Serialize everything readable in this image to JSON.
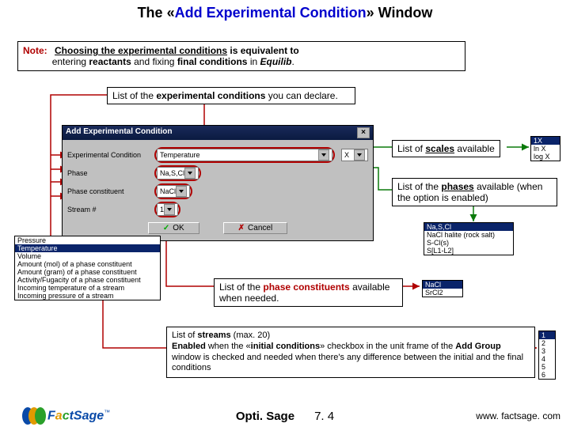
{
  "title": {
    "open": "The «",
    "name": "Add Experimental Condition",
    "close": "» ",
    "win": "Window"
  },
  "note": {
    "label": "Note:",
    "line1a": "Choosing the experimental conditions",
    "line1b": " is equivalent to",
    "line2a": "entering ",
    "line2b": "reactants",
    "line2c": " and fixing ",
    "line2d": "final conditions",
    "line2e": " in ",
    "line2f": "Equilib",
    "line2g": "."
  },
  "labels": {
    "list_exp_a": "List of the ",
    "list_exp_b": "experimental conditions",
    "list_exp_c": " you can declare.",
    "scales_a": "List of ",
    "scales_b": "scales",
    "scales_c": " available",
    "phases_a": "List of the ",
    "phases_b": "phases",
    "phases_c": " available (when the option is enabled)",
    "cons_a": "List of the ",
    "cons_b": "phase constituents",
    "cons_c": " available when needed.",
    "streams_a": "List of ",
    "streams_b": "streams",
    "streams_c": " (max. 20)",
    "streams_d": "Enabled",
    "streams_e": " when the «",
    "streams_f": "initial conditions",
    "streams_g": "» checkbox in the unit frame of the ",
    "streams_h": "Add Group",
    "streams_i": " window is checked and needed when there's any difference between the initial and the final conditions"
  },
  "dialog": {
    "title": "Add Experimental Condition",
    "rows": {
      "exp": {
        "label": "Experimental Condition",
        "value": "Temperature"
      },
      "phase": {
        "label": "Phase",
        "value": "Na,S,Cl"
      },
      "cons": {
        "label": "Phase constituent",
        "value": "NaCl"
      },
      "stream": {
        "label": "Stream #",
        "value": "1"
      }
    },
    "ok": "OK",
    "cancel": "Cancel",
    "scalebox": "X"
  },
  "dropdowns": {
    "exp": {
      "items": [
        "Pressure",
        "Temperature",
        "Volume",
        "Amount (mol) of a phase constituent",
        "Amount (gram) of a phase constituent",
        "Activity/Fugacity of a phase constituent",
        "Incoming temperature of a stream",
        "Incoming pressure of a stream"
      ],
      "selected": 1
    },
    "scales": {
      "items": [
        "1X",
        "ln X",
        "log X"
      ],
      "selected": 0
    },
    "phases": {
      "items": [
        "Na,S,Cl",
        "NaCl halite (rock salt)",
        "S-Cl(s)",
        "S[L1-L2]"
      ],
      "selected": 0
    },
    "cons": {
      "items": [
        "NaCl",
        "SrCl2"
      ],
      "selected": 0
    },
    "streams": {
      "items": [
        "1",
        "2",
        "3",
        "4",
        "5",
        "6"
      ],
      "selected": 0
    }
  },
  "footer": {
    "module": "Opti. Sage",
    "ver": "7. 4",
    "url": "www. factsage. com"
  }
}
